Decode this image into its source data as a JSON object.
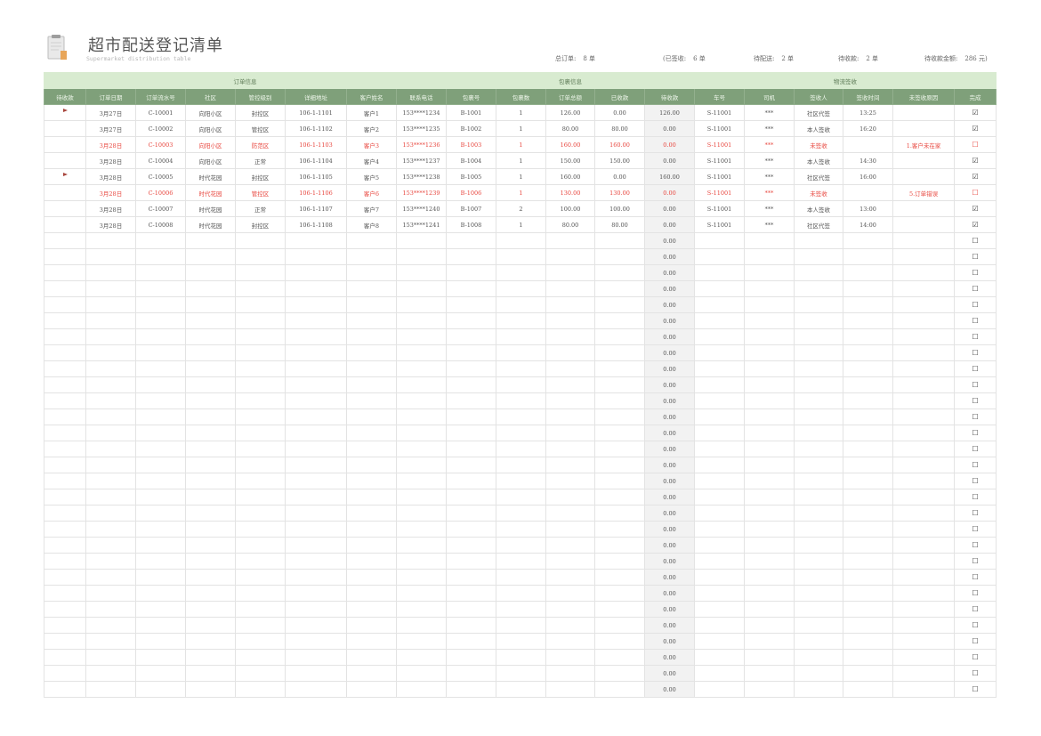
{
  "title": "超市配送登记清单",
  "subtitle": "Supermarket distribution table",
  "stats": {
    "total_label": "总订单:",
    "total_value": "8 单",
    "signed_label": "(已签收:",
    "signed_value": "6 单",
    "todeliver_label": "待配送:",
    "todeliver_value": "2 单",
    "tocollect_label": "待收款:",
    "tocollect_value": "2 单",
    "amount_label": "待收款金额:",
    "amount_value": "286 元)"
  },
  "groups": {
    "order": "订单信息",
    "package": "包裹信息",
    "logistics": "物流签收"
  },
  "columns": [
    "待收款",
    "订单日期",
    "订单流水号",
    "社区",
    "管控级别",
    "详细地址",
    "客户姓名",
    "联系电话",
    "包裹号",
    "包裹数",
    "订单总额",
    "已收款",
    "待收款",
    "车号",
    "司机",
    "签收人",
    "签收时间",
    "未签收原因",
    "完成"
  ],
  "icons": {
    "clipboard": "clipboard-icon",
    "flag": "flag-icon",
    "checked": "checkbox-checked-icon",
    "unchecked": "checkbox-empty-icon"
  },
  "colors": {
    "header_green": "#7fa07a",
    "group_green": "#d8ebd0",
    "alert_red": "#e8473f"
  },
  "rows": [
    {
      "flag": true,
      "red": false,
      "done": true,
      "c": [
        "3月27日",
        "C-10001",
        "向阳小区",
        "封控区",
        "106-1-1101",
        "客户1",
        "153****1234",
        "B-1001",
        "1",
        "126.00",
        "0.00",
        "126.00",
        "S-11001",
        "***",
        "社区代签",
        "13:25",
        ""
      ]
    },
    {
      "flag": false,
      "red": false,
      "done": true,
      "c": [
        "3月27日",
        "C-10002",
        "向阳小区",
        "管控区",
        "106-1-1102",
        "客户2",
        "153****1235",
        "B-1002",
        "1",
        "80.00",
        "80.00",
        "0.00",
        "S-11001",
        "***",
        "本人签收",
        "16:20",
        ""
      ]
    },
    {
      "flag": false,
      "red": true,
      "done": false,
      "c": [
        "3月28日",
        "C-10003",
        "向阳小区",
        "防范区",
        "106-1-1103",
        "客户3",
        "153****1236",
        "B-1003",
        "1",
        "160.00",
        "160.00",
        "0.00",
        "S-11001",
        "***",
        "未签收",
        "",
        "1.客户未在家"
      ]
    },
    {
      "flag": false,
      "red": false,
      "done": true,
      "c": [
        "3月28日",
        "C-10004",
        "向阳小区",
        "正常",
        "106-1-1104",
        "客户4",
        "153****1237",
        "B-1004",
        "1",
        "150.00",
        "150.00",
        "0.00",
        "S-11001",
        "***",
        "本人签收",
        "14:30",
        ""
      ]
    },
    {
      "flag": true,
      "red": false,
      "done": true,
      "c": [
        "3月28日",
        "C-10005",
        "时代花园",
        "封控区",
        "106-1-1105",
        "客户5",
        "153****1238",
        "B-1005",
        "1",
        "160.00",
        "0.00",
        "160.00",
        "S-11001",
        "***",
        "社区代签",
        "16:00",
        ""
      ]
    },
    {
      "flag": false,
      "red": true,
      "done": false,
      "c": [
        "3月28日",
        "C-10006",
        "时代花园",
        "管控区",
        "106-1-1106",
        "客户6",
        "153****1239",
        "B-1006",
        "1",
        "130.00",
        "130.00",
        "0.00",
        "S-11001",
        "***",
        "未签收",
        "",
        "5.订单错误"
      ]
    },
    {
      "flag": false,
      "red": false,
      "done": true,
      "c": [
        "3月28日",
        "C-10007",
        "时代花园",
        "正常",
        "106-1-1107",
        "客户7",
        "153****1240",
        "B-1007",
        "2",
        "100.00",
        "100.00",
        "0.00",
        "S-11001",
        "***",
        "本人签收",
        "13:00",
        ""
      ]
    },
    {
      "flag": false,
      "red": false,
      "done": true,
      "c": [
        "3月28日",
        "C-10008",
        "时代花园",
        "封控区",
        "106-1-1108",
        "客户8",
        "153****1241",
        "B-1008",
        "1",
        "80.00",
        "80.00",
        "0.00",
        "S-11001",
        "***",
        "社区代签",
        "14:00",
        ""
      ]
    }
  ],
  "empty_row_pending": "0.00",
  "empty_row_count": 29
}
